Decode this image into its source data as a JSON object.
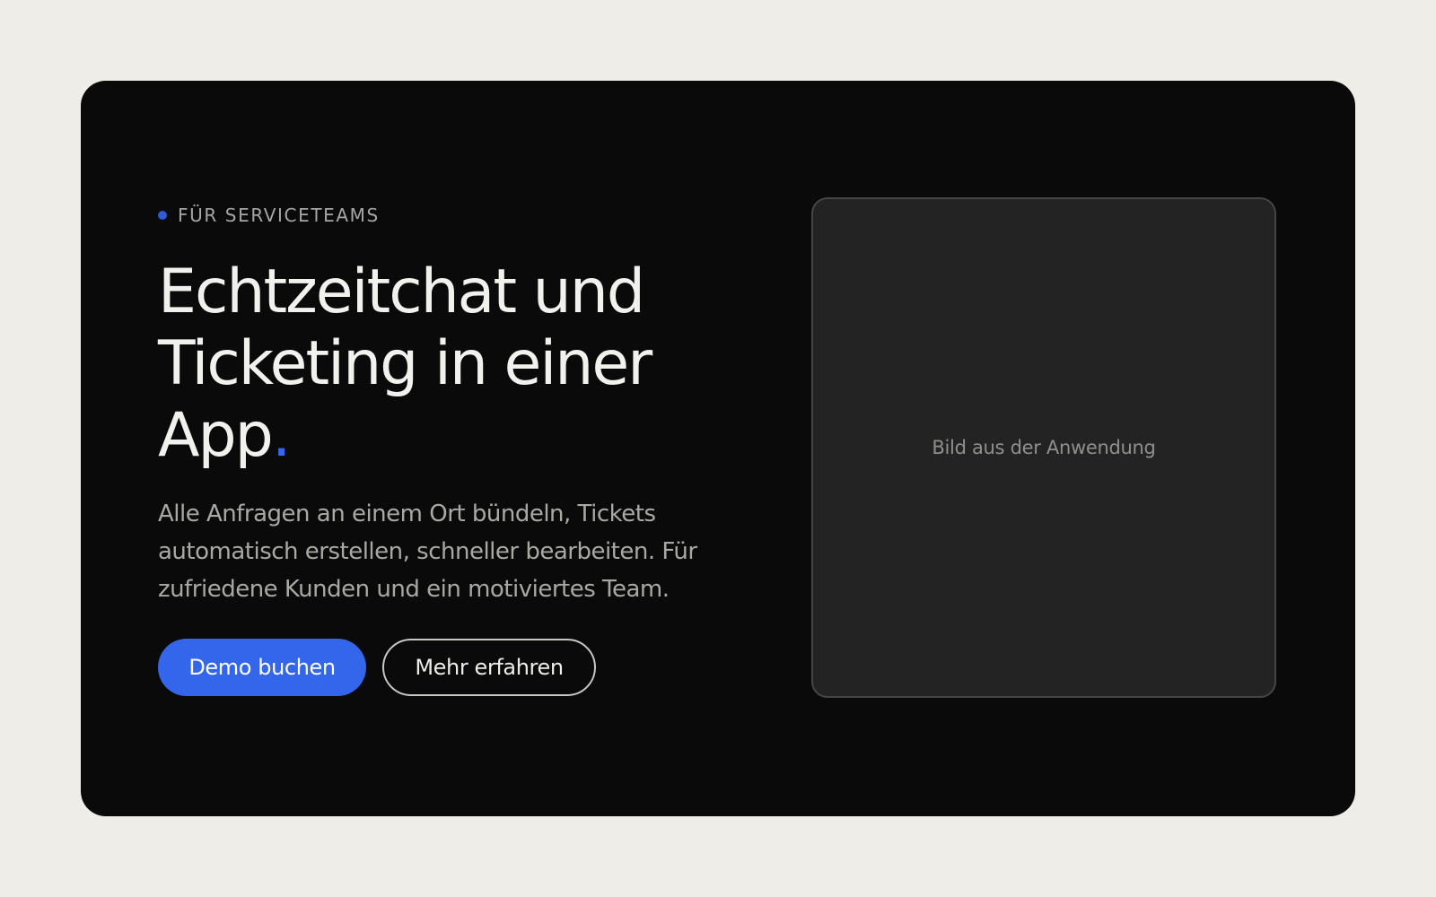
{
  "hero": {
    "eyebrow": "FÜR SERVICETEAMS",
    "headline_lines": [
      "Echtzeitchat und",
      "Ticketing in einer",
      "App"
    ],
    "headline_end": ".",
    "description": "Alle Anfragen an einem Ort bündeln, Tickets automatisch erstellen, schneller bearbeiten. Für zufriedene Kunden und ein motiviertes Team.",
    "primary_button": "Demo buchen",
    "secondary_button": "Mehr erfahren",
    "image_placeholder": "Bild aus der Anwendung"
  },
  "colors": {
    "page_background": "#eeede8",
    "card_background": "#0a0a0a",
    "accent": "#3366ea",
    "panel_background": "#232323"
  },
  "icons": {
    "eyebrow_marker": "dot-icon"
  }
}
